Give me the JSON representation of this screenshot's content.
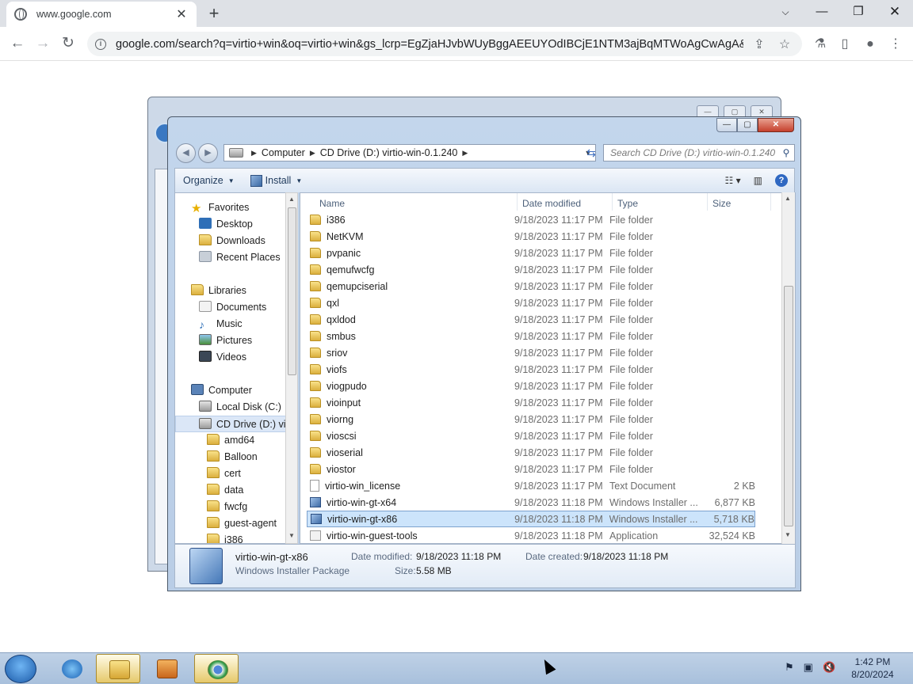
{
  "browser": {
    "tab_title": "www.google.com",
    "url": "google.com/search?q=virtio+win&oq=virtio+win&gs_lcrp=EgZjaHJvbWUyBggAEEUYOdIBCjE1NTM3ajBqMTWoAgCwAgA&sour..."
  },
  "explorer": {
    "breadcrumb": [
      "Computer",
      "CD Drive (D:) virtio-win-0.1.240"
    ],
    "search_placeholder": "Search CD Drive (D:) virtio-win-0.1.240",
    "toolbar": {
      "organize": "Organize",
      "install": "Install"
    },
    "nav": {
      "favorites": "Favorites",
      "desktop": "Desktop",
      "downloads": "Downloads",
      "recent": "Recent Places",
      "libraries": "Libraries",
      "documents": "Documents",
      "music": "Music",
      "pictures": "Pictures",
      "videos": "Videos",
      "computer": "Computer",
      "local_disk": "Local Disk (C:)",
      "cd_drive": "CD Drive (D:) virt",
      "subfolders": [
        "amd64",
        "Balloon",
        "cert",
        "data",
        "fwcfg",
        "guest-agent",
        "i386"
      ]
    },
    "columns": {
      "name": "Name",
      "date": "Date modified",
      "type": "Type",
      "size": "Size"
    },
    "files": [
      {
        "name": "i386",
        "date": "9/18/2023 11:17 PM",
        "type": "File folder",
        "size": "",
        "icon": "folder"
      },
      {
        "name": "NetKVM",
        "date": "9/18/2023 11:17 PM",
        "type": "File folder",
        "size": "",
        "icon": "folder"
      },
      {
        "name": "pvpanic",
        "date": "9/18/2023 11:17 PM",
        "type": "File folder",
        "size": "",
        "icon": "folder"
      },
      {
        "name": "qemufwcfg",
        "date": "9/18/2023 11:17 PM",
        "type": "File folder",
        "size": "",
        "icon": "folder"
      },
      {
        "name": "qemupciserial",
        "date": "9/18/2023 11:17 PM",
        "type": "File folder",
        "size": "",
        "icon": "folder"
      },
      {
        "name": "qxl",
        "date": "9/18/2023 11:17 PM",
        "type": "File folder",
        "size": "",
        "icon": "folder"
      },
      {
        "name": "qxldod",
        "date": "9/18/2023 11:17 PM",
        "type": "File folder",
        "size": "",
        "icon": "folder"
      },
      {
        "name": "smbus",
        "date": "9/18/2023 11:17 PM",
        "type": "File folder",
        "size": "",
        "icon": "folder"
      },
      {
        "name": "sriov",
        "date": "9/18/2023 11:17 PM",
        "type": "File folder",
        "size": "",
        "icon": "folder"
      },
      {
        "name": "viofs",
        "date": "9/18/2023 11:17 PM",
        "type": "File folder",
        "size": "",
        "icon": "folder"
      },
      {
        "name": "viogpudo",
        "date": "9/18/2023 11:17 PM",
        "type": "File folder",
        "size": "",
        "icon": "folder"
      },
      {
        "name": "vioinput",
        "date": "9/18/2023 11:17 PM",
        "type": "File folder",
        "size": "",
        "icon": "folder"
      },
      {
        "name": "viorng",
        "date": "9/18/2023 11:17 PM",
        "type": "File folder",
        "size": "",
        "icon": "folder"
      },
      {
        "name": "vioscsi",
        "date": "9/18/2023 11:17 PM",
        "type": "File folder",
        "size": "",
        "icon": "folder"
      },
      {
        "name": "vioserial",
        "date": "9/18/2023 11:17 PM",
        "type": "File folder",
        "size": "",
        "icon": "folder"
      },
      {
        "name": "viostor",
        "date": "9/18/2023 11:17 PM",
        "type": "File folder",
        "size": "",
        "icon": "folder"
      },
      {
        "name": "virtio-win_license",
        "date": "9/18/2023 11:17 PM",
        "type": "Text Document",
        "size": "2 KB",
        "icon": "text"
      },
      {
        "name": "virtio-win-gt-x64",
        "date": "9/18/2023 11:18 PM",
        "type": "Windows Installer ...",
        "size": "6,877 KB",
        "icon": "msi"
      },
      {
        "name": "virtio-win-gt-x86",
        "date": "9/18/2023 11:18 PM",
        "type": "Windows Installer ...",
        "size": "5,718 KB",
        "icon": "msi",
        "selected": true
      },
      {
        "name": "virtio-win-guest-tools",
        "date": "9/18/2023 11:18 PM",
        "type": "Application",
        "size": "32,524 KB",
        "icon": "app"
      }
    ],
    "details": {
      "name": "virtio-win-gt-x86",
      "kind": "Windows Installer Package",
      "modified_label": "Date modified:",
      "modified": "9/18/2023 11:18 PM",
      "created_label": "Date created:",
      "created": "9/18/2023 11:18 PM",
      "size_label": "Size:",
      "size": "5.58 MB"
    }
  },
  "taskbar": {
    "time": "1:42 PM",
    "date": "8/20/2024"
  }
}
